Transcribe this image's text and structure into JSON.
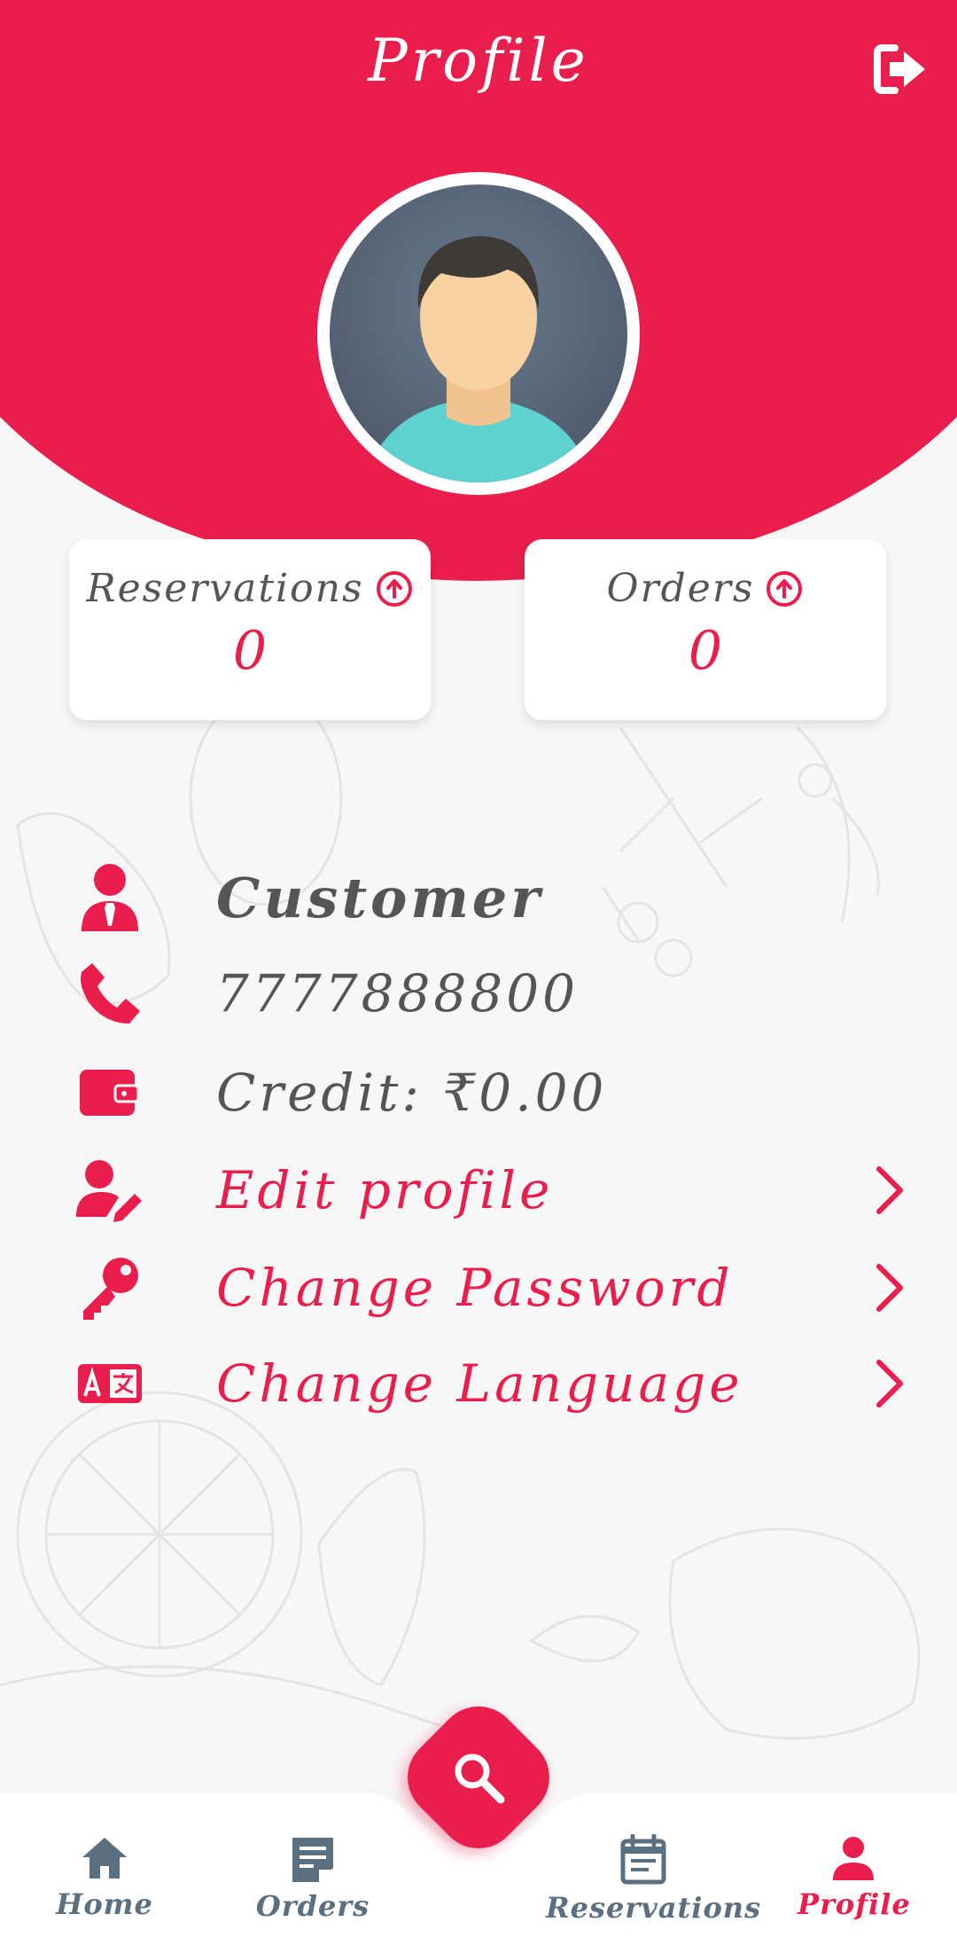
{
  "header": {
    "title": "Profile"
  },
  "stats": [
    {
      "label": "Reservations",
      "value": "0"
    },
    {
      "label": "Orders",
      "value": "0"
    }
  ],
  "profile": {
    "name": "Customer",
    "phone": "7777888800",
    "credit": "Credit:  ₹0.00"
  },
  "menu": {
    "edit_profile": "Edit profile",
    "change_password": "Change Password",
    "change_language": "Change Language"
  },
  "nav": [
    {
      "label": "Home",
      "icon": "home-icon"
    },
    {
      "label": "Orders",
      "icon": "orders-icon"
    },
    {
      "label": "Reservations",
      "icon": "calendar-icon"
    },
    {
      "label": "Profile",
      "icon": "person-icon"
    }
  ],
  "colors": {
    "accent": "#e91e4c",
    "nav_inactive": "#5a6f80",
    "text": "#555555",
    "background": "#f7f7f7"
  }
}
